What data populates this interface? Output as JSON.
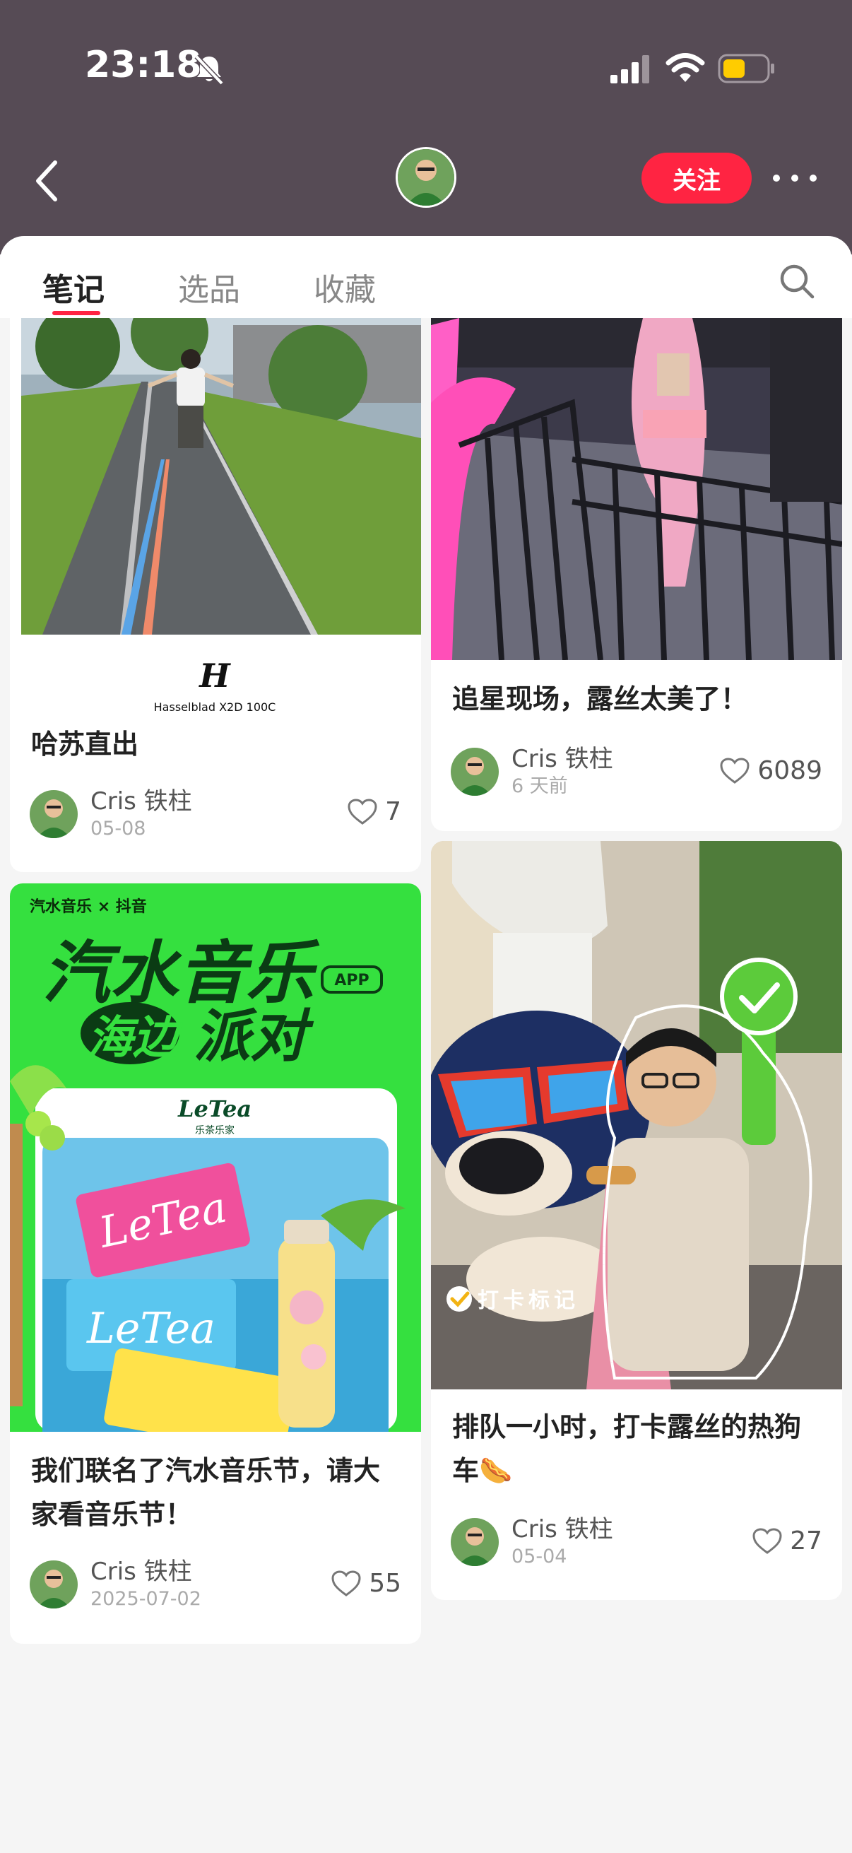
{
  "status_bar": {
    "time": "23:18"
  },
  "header": {
    "follow_label": "关注"
  },
  "tabs": [
    {
      "label": "笔记",
      "active": true
    },
    {
      "label": "选品",
      "active": false
    },
    {
      "label": "收藏",
      "active": false
    }
  ],
  "notes": [
    {
      "title": "哈苏直出",
      "author": "Cris 铁柱",
      "date": "05-08",
      "likes": "7",
      "image_caption": "Hasselblad X2D 100C"
    },
    {
      "title": "追星现场，露丝太美了！",
      "author": "Cris 铁柱",
      "date": "6 天前",
      "likes": "6089"
    },
    {
      "title": "我们联名了汽水音乐节，请大家看音乐节！",
      "author": "Cris 铁柱",
      "date": "2025-07-02",
      "likes": "55",
      "poster": {
        "brand_left": "汽水音乐",
        "brand_x": "×",
        "brand_right": "抖音",
        "headline": "汽水音乐",
        "app_tag": "APP",
        "subline_a": "海边",
        "subline_b": "派对",
        "partner": "LeTea",
        "partner_sub": "乐茶乐家",
        "product": "LeTea"
      }
    },
    {
      "title": "排队一小时，打卡露丝的热狗车🌭",
      "author": "Cris 铁柱",
      "date": "05-04",
      "likes": "27",
      "checkin_tag": "打卡标记"
    }
  ],
  "colors": {
    "accent": "#ff2442",
    "header_bg": "#564b55",
    "poster_green": "#35e03f"
  }
}
